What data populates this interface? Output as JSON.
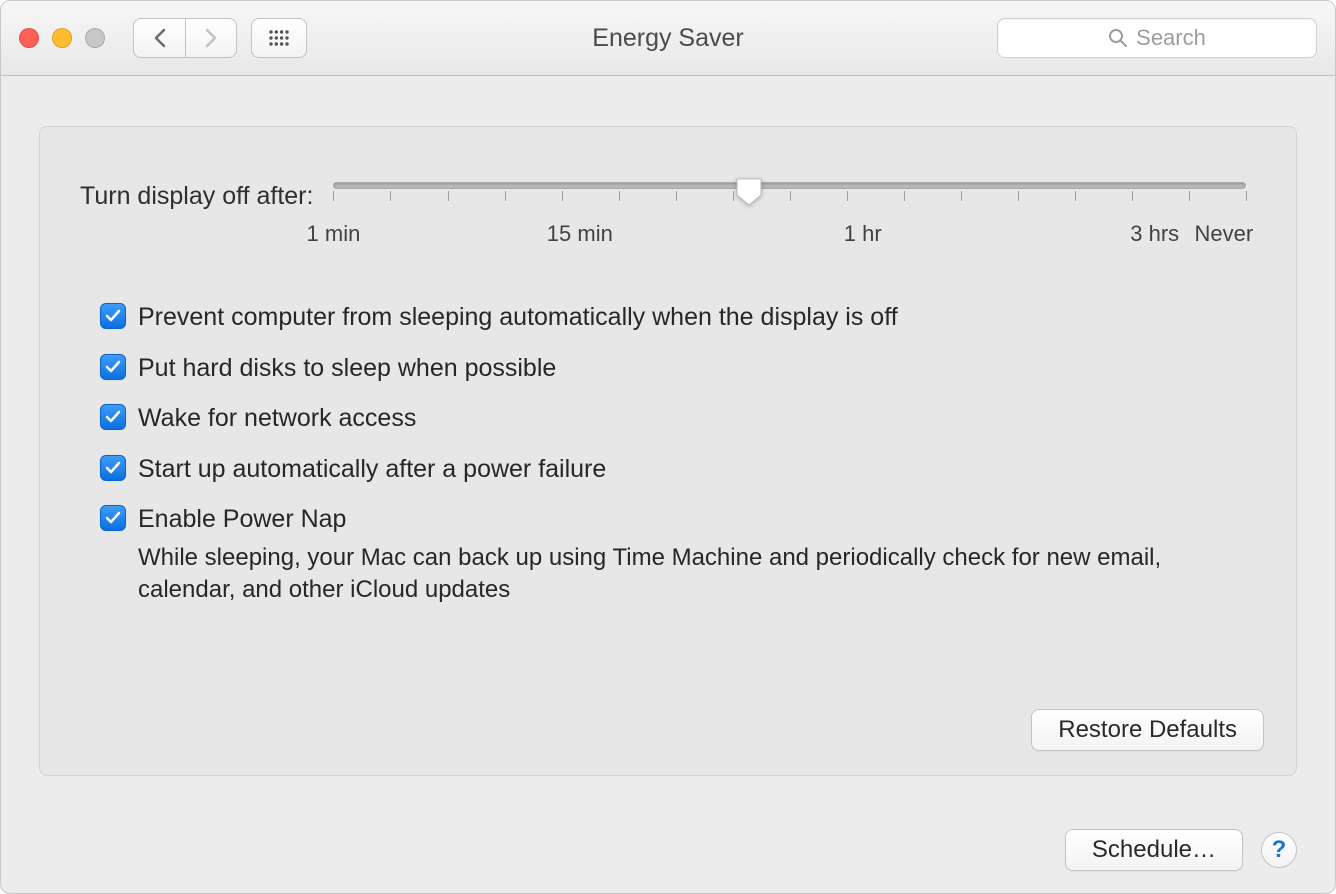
{
  "window": {
    "title": "Energy Saver",
    "search_placeholder": "Search"
  },
  "panel": {
    "slider_label": "Turn display off after:",
    "slider_ticks": [
      "1 min",
      "15 min",
      "1 hr",
      "3 hrs",
      "Never"
    ],
    "slider_position_percent": 45.5
  },
  "options": [
    {
      "id": "prevent-sleep",
      "label": "Prevent computer from sleeping automatically when the display is off",
      "checked": true
    },
    {
      "id": "hard-disks",
      "label": "Put hard disks to sleep when possible",
      "checked": true
    },
    {
      "id": "wake-network",
      "label": "Wake for network access",
      "checked": true
    },
    {
      "id": "power-failure",
      "label": "Start up automatically after a power failure",
      "checked": true
    },
    {
      "id": "power-nap",
      "label": "Enable Power Nap",
      "checked": true,
      "description": "While sleeping, your Mac can back up using Time Machine and periodically check for new email, calendar, and other iCloud updates"
    }
  ],
  "buttons": {
    "restore_defaults": "Restore Defaults",
    "schedule": "Schedule…",
    "help": "?"
  }
}
